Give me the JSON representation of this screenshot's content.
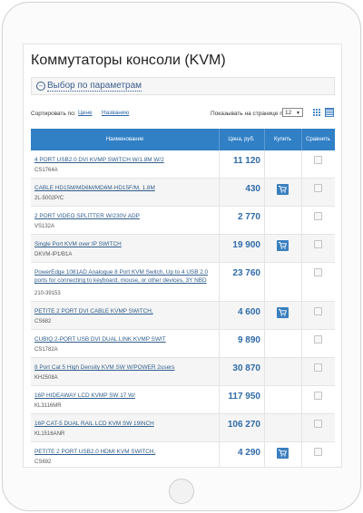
{
  "page": {
    "title": "Коммутаторы консоли (KVM)",
    "filter_label": "Выбор по параметрам"
  },
  "sort": {
    "label": "Сортировать по:",
    "by_price": "Цене",
    "by_name": "Названию"
  },
  "per_page": {
    "label": "Показывать на странице по:",
    "value": "12"
  },
  "table": {
    "headers": {
      "name": "Наименование",
      "price": "Цена, руб.",
      "buy": "Купить",
      "compare": "Сравнить"
    },
    "rows": [
      {
        "title": "4 PORT USB2.0 DVI KVMP SWITCH W/1.8M W/2",
        "code": "CS1764A",
        "price": "11 120",
        "cart": false
      },
      {
        "title": "CABLE HD15M/MD6M/MD6M-HD15F/M, 1.8M",
        "code": "2L-5002P/C",
        "price": "430",
        "cart": true
      },
      {
        "title": "2 PORT VIDEO SPLITTER W/230V ADP",
        "code": "VS132A",
        "price": "2 770",
        "cart": false
      },
      {
        "title": "Single Port KVM over IP SWITCH",
        "code": "DKVM-IP1/B1A",
        "price": "19 900",
        "cart": true
      },
      {
        "title": "PowerEdge 1081AD Analogue 8 Port KVM Switch, Up to 4 USB 2.0 ports for connecting to keyboard, mouse, or other devices, 3Y NBD",
        "code": "210-39153",
        "price": "23 760",
        "cart": false
      },
      {
        "title": "PETITE 2 PORT DVI CABLE KVMP SWITCH,",
        "code": "CS682",
        "price": "4 600",
        "cart": true
      },
      {
        "title": "CUBIQ 2-PORT USB DVI DUAL LINK KVMP SWIT",
        "code": "CS1782A",
        "price": "9 890",
        "cart": false
      },
      {
        "title": "8 Port Cat 5 High Density KVM SW W/POWER 2users",
        "code": "KH2508A",
        "price": "30 870",
        "cart": false
      },
      {
        "title": "16P HIDEAWAY LCD KVMP SW 17 W/",
        "code": "KL3116MR",
        "price": "117 950",
        "cart": false
      },
      {
        "title": "16P CAT-5 DUAL RAIL LCD KVM SW 19INCH",
        "code": "KL1516ANR",
        "price": "106 270",
        "cart": false
      },
      {
        "title": "PETITE 2 PORT USB2.0 HDMI KVM SWITCH,",
        "code": "CS692",
        "price": "4 290",
        "cart": true
      }
    ]
  },
  "icons": {
    "filter": "filter-toggle-icon",
    "cart": "cart-icon",
    "grid_view": "grid-view-icon",
    "list_view": "list-view-icon"
  },
  "colors": {
    "header_bg": "#3180c6",
    "link": "#2f5d8c",
    "price": "#2f6ba8",
    "cart_bg": "#3a7fbf"
  }
}
